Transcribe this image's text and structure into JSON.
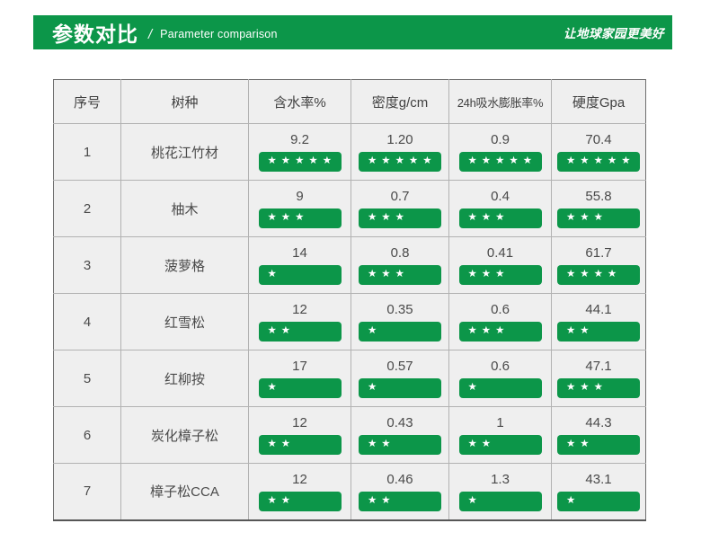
{
  "colors": {
    "brand_green": "#0c9649",
    "cell_bg": "#efefef"
  },
  "banner": {
    "title_zh": "参数对比",
    "separator": "/",
    "title_en": "Parameter comparison",
    "slogan": "让地球家园更美好"
  },
  "table": {
    "headers": [
      "序号",
      "树种",
      "含水率%",
      "密度g/cm",
      "24h吸水膨胀率%",
      "硬度Gpa"
    ],
    "rows": [
      {
        "no": "1",
        "species": "桃花江竹材",
        "metrics": [
          {
            "value": "9.2",
            "stars": 5
          },
          {
            "value": "1.20",
            "stars": 5
          },
          {
            "value": "0.9",
            "stars": 5
          },
          {
            "value": "70.4",
            "stars": 5
          }
        ]
      },
      {
        "no": "2",
        "species": "柚木",
        "metrics": [
          {
            "value": "9",
            "stars": 3
          },
          {
            "value": "0.7",
            "stars": 3
          },
          {
            "value": "0.4",
            "stars": 3
          },
          {
            "value": "55.8",
            "stars": 3
          }
        ]
      },
      {
        "no": "3",
        "species": "菠萝格",
        "metrics": [
          {
            "value": "14",
            "stars": 1
          },
          {
            "value": "0.8",
            "stars": 3
          },
          {
            "value": "0.41",
            "stars": 3
          },
          {
            "value": "61.7",
            "stars": 4
          }
        ]
      },
      {
        "no": "4",
        "species": "红雪松",
        "metrics": [
          {
            "value": "12",
            "stars": 2
          },
          {
            "value": "0.35",
            "stars": 1
          },
          {
            "value": "0.6",
            "stars": 3
          },
          {
            "value": "44.1",
            "stars": 2
          }
        ]
      },
      {
        "no": "5",
        "species": "红柳按",
        "metrics": [
          {
            "value": "17",
            "stars": 1
          },
          {
            "value": "0.57",
            "stars": 1
          },
          {
            "value": "0.6",
            "stars": 1
          },
          {
            "value": "47.1",
            "stars": 3
          }
        ]
      },
      {
        "no": "6",
        "species": "炭化樟子松",
        "metrics": [
          {
            "value": "12",
            "stars": 2
          },
          {
            "value": "0.43",
            "stars": 2
          },
          {
            "value": "1",
            "stars": 2
          },
          {
            "value": "44.3",
            "stars": 2
          }
        ]
      },
      {
        "no": "7",
        "species": "樟子松CCA",
        "metrics": [
          {
            "value": "12",
            "stars": 2
          },
          {
            "value": "0.46",
            "stars": 2
          },
          {
            "value": "1.3",
            "stars": 1
          },
          {
            "value": "43.1",
            "stars": 1
          }
        ]
      }
    ]
  },
  "chart_data": {
    "type": "table",
    "title": "参数对比 / Parameter comparison",
    "columns": [
      "序号",
      "树种",
      "含水率%",
      "密度g/cm",
      "24h吸水膨胀率%",
      "硬度Gpa"
    ],
    "star_scale": [
      1,
      5
    ],
    "rows": [
      {
        "no": 1,
        "species": "桃花江竹材",
        "moisture_pct": 9.2,
        "moisture_stars": 5,
        "density_g_cm": 1.2,
        "density_stars": 5,
        "swell_24h_pct": 0.9,
        "swell_stars": 5,
        "hardness_gpa": 70.4,
        "hardness_stars": 5
      },
      {
        "no": 2,
        "species": "柚木",
        "moisture_pct": 9,
        "moisture_stars": 3,
        "density_g_cm": 0.7,
        "density_stars": 3,
        "swell_24h_pct": 0.4,
        "swell_stars": 3,
        "hardness_gpa": 55.8,
        "hardness_stars": 3
      },
      {
        "no": 3,
        "species": "菠萝格",
        "moisture_pct": 14,
        "moisture_stars": 1,
        "density_g_cm": 0.8,
        "density_stars": 3,
        "swell_24h_pct": 0.41,
        "swell_stars": 3,
        "hardness_gpa": 61.7,
        "hardness_stars": 4
      },
      {
        "no": 4,
        "species": "红雪松",
        "moisture_pct": 12,
        "moisture_stars": 2,
        "density_g_cm": 0.35,
        "density_stars": 1,
        "swell_24h_pct": 0.6,
        "swell_stars": 3,
        "hardness_gpa": 44.1,
        "hardness_stars": 2
      },
      {
        "no": 5,
        "species": "红柳按",
        "moisture_pct": 17,
        "moisture_stars": 1,
        "density_g_cm": 0.57,
        "density_stars": 1,
        "swell_24h_pct": 0.6,
        "swell_stars": 1,
        "hardness_gpa": 47.1,
        "hardness_stars": 3
      },
      {
        "no": 6,
        "species": "炭化樟子松",
        "moisture_pct": 12,
        "moisture_stars": 2,
        "density_g_cm": 0.43,
        "density_stars": 2,
        "swell_24h_pct": 1,
        "swell_stars": 2,
        "hardness_gpa": 44.3,
        "hardness_stars": 2
      },
      {
        "no": 7,
        "species": "樟子松CCA",
        "moisture_pct": 12,
        "moisture_stars": 2,
        "density_g_cm": 0.46,
        "density_stars": 2,
        "swell_24h_pct": 1.3,
        "swell_stars": 1,
        "hardness_gpa": 43.1,
        "hardness_stars": 1
      }
    ]
  }
}
